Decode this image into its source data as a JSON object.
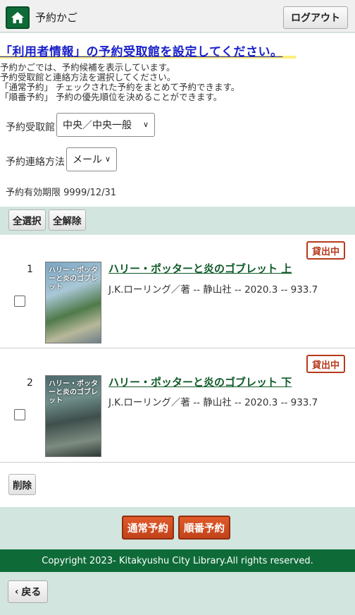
{
  "header": {
    "title": "予約かご",
    "logout_label": "ログアウト",
    "home_icon": "home-icon"
  },
  "notice": "「利用者情報」の予約受取館を設定してください。",
  "intro_lines": [
    "予約かごでは、予約候補を表示しています。",
    "予約受取館と連絡方法を選択してください。",
    "「通常予約」 チェックされた予約をまとめて予約できます。",
    "「順番予約」 予約の優先順位を決めることができます。"
  ],
  "pickup": {
    "label": "予約受取館",
    "value": "中央／中央一般"
  },
  "contact": {
    "label": "予約連絡方法",
    "value": "メール"
  },
  "expiry": "予約有効期限 9999/12/31",
  "select_all_label": "全選択",
  "deselect_all_label": "全解除",
  "items": [
    {
      "num": "1",
      "status": "貸出中",
      "title": "ハリー・ポッターと炎のゴブレット 上",
      "meta": "J.K.ローリング／著 -- 静山社 -- 2020.3 -- 933.7",
      "cover_text": "ハリー・ポッターと炎のゴブレット"
    },
    {
      "num": "2",
      "status": "貸出中",
      "title": "ハリー・ポッターと炎のゴブレット 下",
      "meta": "J.K.ローリング／著 -- 静山社 -- 2020.3 -- 933.7",
      "cover_text": "ハリー・ポッターと炎のゴブレット"
    }
  ],
  "delete_label": "削除",
  "normal_reserve_label": "通常予約",
  "order_reserve_label": "順番予約",
  "footer": "Copyright 2023- Kitakyushu City Library.All rights reserved.",
  "back_label": "戻る",
  "colors": {
    "brand_green": "#0e6b38",
    "accent_orange": "#c2431a",
    "link_blue": "#1a22c8",
    "page_bg": "#d2e5de"
  }
}
